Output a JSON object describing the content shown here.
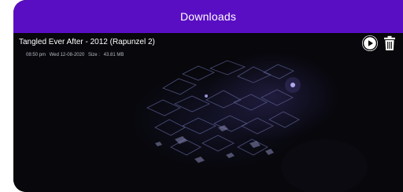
{
  "appbar": {
    "title": "Downloads",
    "color": "#5a0ec4"
  },
  "download_item": {
    "title": "Tangled Ever After - 2012 (Rapunzel 2)",
    "time": "08:50 pm",
    "date": "Wed 12-08-2020",
    "size_label": "Size :",
    "size_value": "43.81 MB",
    "icons": {
      "play": "play-circle-icon",
      "delete": "trash-icon"
    }
  }
}
